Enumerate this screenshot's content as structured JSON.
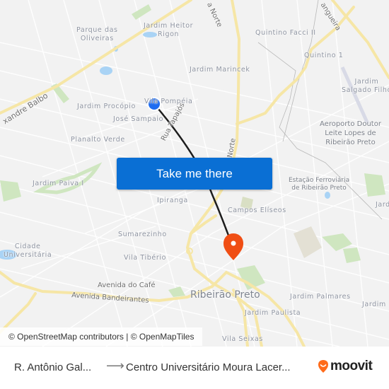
{
  "map": {
    "labels": {
      "parque_das_oliveiras": "Parque das\nOliveiras",
      "jardim_heitor_rigon": "Jardim Heitor\nRigon",
      "quintino_facci_ii": "Quintino Facci II",
      "quintino_1": "Quintino 1",
      "jardim_marincek": "Jardim Marincek",
      "jardim_salgado_filho": "Jardim\nSalgado Filho",
      "jardim_procopio": "Jardim Procópio",
      "vila_pompeia": "Vila Pompéia",
      "jose_sampaio": "José Sampaio",
      "planalto_verde": "Planalto Verde",
      "aeroporto": "Aeroporto Doutor\nLeite Lopes de\nRibeirão Preto",
      "jardim_paiva_i": "Jardim Paiva I",
      "estacao": "Estação Ferroviária\nde Ribeirão Preto",
      "ipiranga": "Ipiranga",
      "campos_eliseos": "Campos Elíseos",
      "sumarezinho": "Sumarezinho",
      "cidade_universitaria": "Cidade\nUniversitária",
      "vila_tiberio": "Vila Tibério",
      "avenida_do_cafe": "Avenida do Café",
      "avenida_bandeirantes": "Avenida Bandeirantes",
      "ribeirao_preto": "Ribeirão Preto",
      "jardim_palmares": "Jardim Palmares",
      "jardim_paulista": "Jardim Paulista",
      "vila_seixas": "Vila Seixas",
      "jardim_right": "Jardim",
      "jardim_right2": "Jard",
      "rua_tapajos": "Rua Tapajós",
      "via_norte_top": "a Norte",
      "via_norte_mid": "Norte",
      "mangueira": "angueira",
      "alexandre_balbo": "xandre Balbo"
    },
    "origin_marker_color": "#1e6cf0",
    "destination_marker_color": "#f04e14",
    "route_color": "#1d1d1d",
    "cta_label": "Take me there",
    "attribution": "© OpenStreetMap contributors | © OpenMapTiles"
  },
  "footer": {
    "origin": "R. Antônio Gal...",
    "arrow": "⟶",
    "destination": "Centro Universitário Moura Lacer...",
    "brand": "moovit",
    "brand_color": "#ff6b1a"
  }
}
